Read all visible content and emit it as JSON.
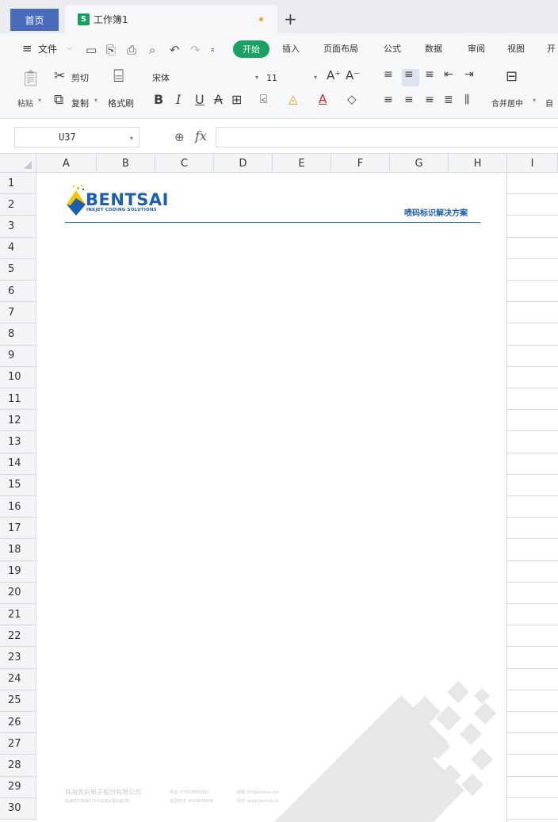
{
  "tabs": {
    "home": "首页",
    "workbook": "工作簿1",
    "sheet_icon": "S",
    "new_tab": "+"
  },
  "menu": {
    "file": "文件",
    "start": "开始",
    "insert": "插入",
    "layout": "页面布局",
    "formula": "公式",
    "data": "数据",
    "review": "审阅",
    "view": "视图",
    "dev": "开"
  },
  "ribbon": {
    "cut": "剪切",
    "paste": "粘贴",
    "copy": "复制",
    "format_painter": "格式刷",
    "font_name": "宋体",
    "font_size": "11",
    "merge": "合并居中",
    "auto": "自"
  },
  "formula_bar": {
    "cell_ref": "U37",
    "fx": "fx"
  },
  "columns": [
    "A",
    "B",
    "C",
    "D",
    "E",
    "F",
    "G",
    "H",
    "I"
  ],
  "rows": [
    "1",
    "2",
    "3",
    "4",
    "5",
    "6",
    "7",
    "8",
    "9",
    "10",
    "11",
    "12",
    "13",
    "14",
    "15",
    "16",
    "17",
    "18",
    "19",
    "20",
    "21",
    "22",
    "23",
    "24",
    "25",
    "26",
    "27",
    "28",
    "29",
    "30"
  ],
  "letterhead": {
    "brand": "BENTSAI",
    "brand_sub": "INKJET CODING SOLUTIONS",
    "slogan": "喷码标识解决方案",
    "company": "珠海奔彩电子股份有限公司",
    "address": "珠海市华威路115号信成大厦A座2楼",
    "tel": "电话: 0756-8895581",
    "hotline": "全国热线: 4009638508",
    "email": "邮箱: BS@bentsai.net",
    "web": "网址: www.bentsai.cn"
  },
  "colors": {
    "accent_green": "#1aa262",
    "home_tab": "#4a6dbb",
    "brand_blue": "#1c5fb0",
    "brand_yellow": "#f5c400"
  }
}
